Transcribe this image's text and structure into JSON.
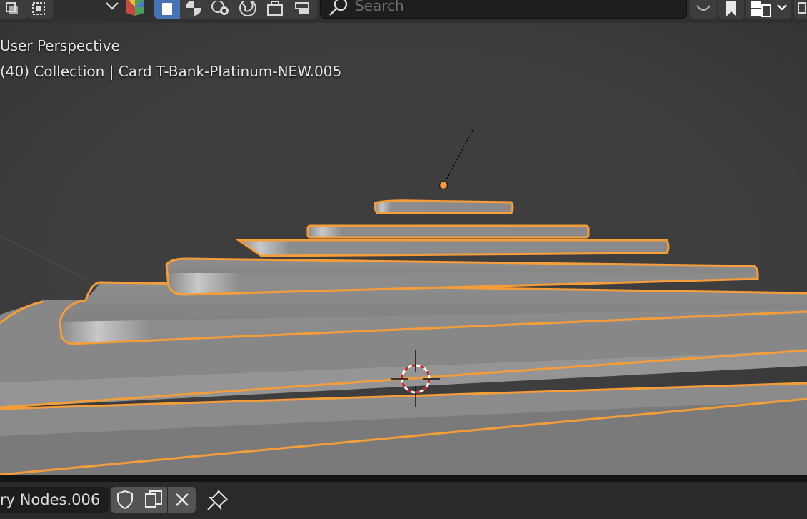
{
  "header": {
    "search": {
      "placeholder": "Search"
    }
  },
  "viewport": {
    "perspective_label": "User Perspective",
    "collection_label": "(40) Collection | Card T-Bank-Platinum-NEW.005"
  },
  "bottom_bar": {
    "node_group_name": "ry Nodes.006"
  },
  "colors": {
    "accent_blue": "#4772b3",
    "selection_outline": "#f59d38",
    "viewport_bg": "#3d3d3d",
    "header_bg": "#303030"
  }
}
